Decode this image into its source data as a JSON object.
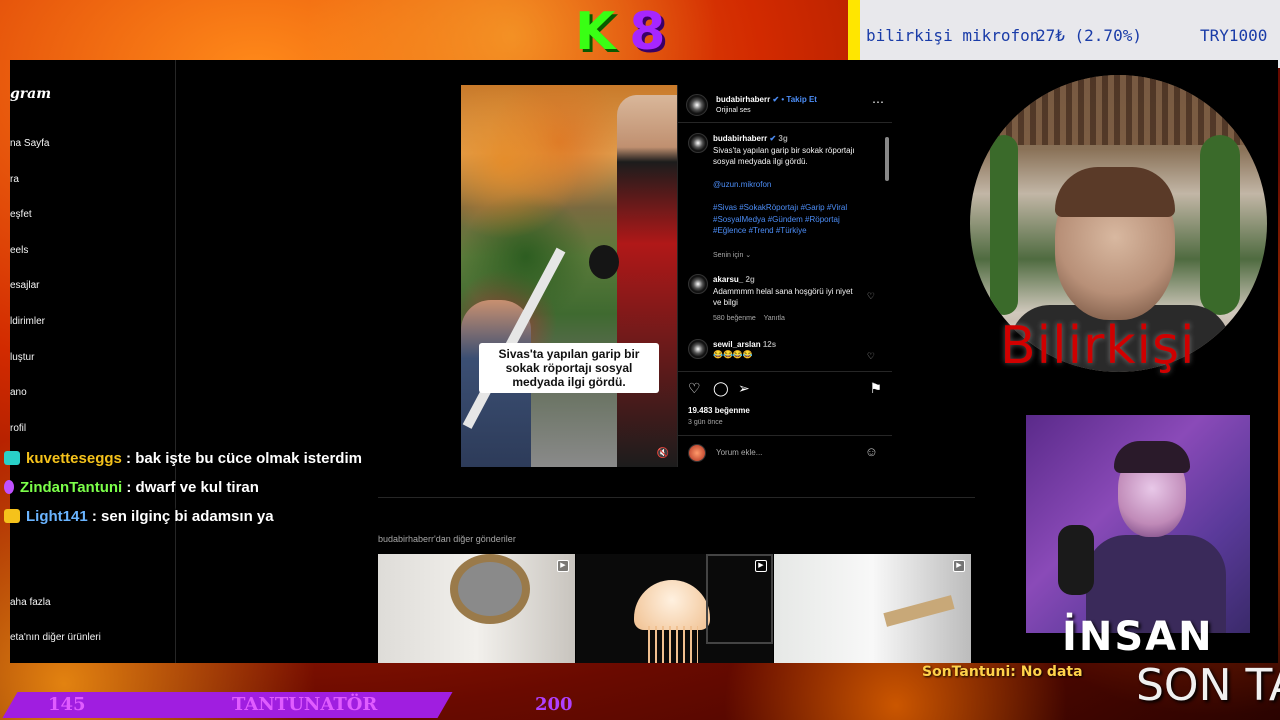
{
  "overlay": {
    "logo_k": "K",
    "logo_8": "8",
    "ticker": {
      "item": "bilirkişi mikrofon",
      "price": "27₺ (2.70%)",
      "target": "TRY1000"
    },
    "cam_label": "Bilirkişi",
    "insan_label": "İNSAN",
    "son_ta_label": "SON TA",
    "son_tantuni_label": "SonTantuni: No data",
    "goal": {
      "current": "145",
      "title": "TANTUNATÖR",
      "target": "200",
      "progress": 0.725
    }
  },
  "chat": [
    {
      "user": "kuvetteseggs",
      "message": ": bak işte bu cüce olmak isterdim",
      "color": "#f5c21b",
      "badge_color": "#29d0c8"
    },
    {
      "user": "ZindanTantuni",
      "message": ": dwarf ve kul tiran",
      "color": "#7cff4a",
      "badge_color": "#c050ff"
    },
    {
      "user": "Light141",
      "message": ": sen ilginç bi adamsın ya",
      "color": "#6ab4ff",
      "badge_color": "#f5c21b"
    }
  ],
  "instagram": {
    "logo": "gram",
    "nav": [
      "na Sayfa",
      "ra",
      "eşfet",
      "eels",
      "esajlar",
      "ldirimler",
      "luştur",
      "ano",
      "rofil",
      "aha fazla",
      "eta'nın diğer ürünleri"
    ],
    "post": {
      "username": "budabirhaberr",
      "follow": "• Takip Et",
      "audio": "Orijinal ses",
      "more_icon": "⋯",
      "caption_time": "3g",
      "caption": "Sivas'ta yapılan garip bir sokak röportajı sosyal medyada ilgi gördü.",
      "mention": "@uzun.mikrofon",
      "hashtags": "#Sivas #SokakRöportajı #Garip #Viral #SosyalMedya #Gündem #Röportaj #Eğlence #Trend #Türkiye",
      "translation": "Senin için",
      "video_caption": "Sivas'ta yapılan garip bir sokak röportajı sosyal medyada ilgi gördü.",
      "comments": [
        {
          "user": "akarsu_",
          "time": "2g",
          "text": "Adammmm helal sana hoşgörü iyi niyet ve bilgi",
          "likes": "580 beğenme",
          "reply": "Yanıtla"
        },
        {
          "user": "sewil_arslan",
          "time": "12s",
          "text": "😂😂😂😂"
        }
      ],
      "likes": "19.483 beğenme",
      "posted": "3 gün önce",
      "comment_placeholder": "Yorum ekle..."
    },
    "more_from": "budabirhaberr'dan diğer gönderiler"
  }
}
